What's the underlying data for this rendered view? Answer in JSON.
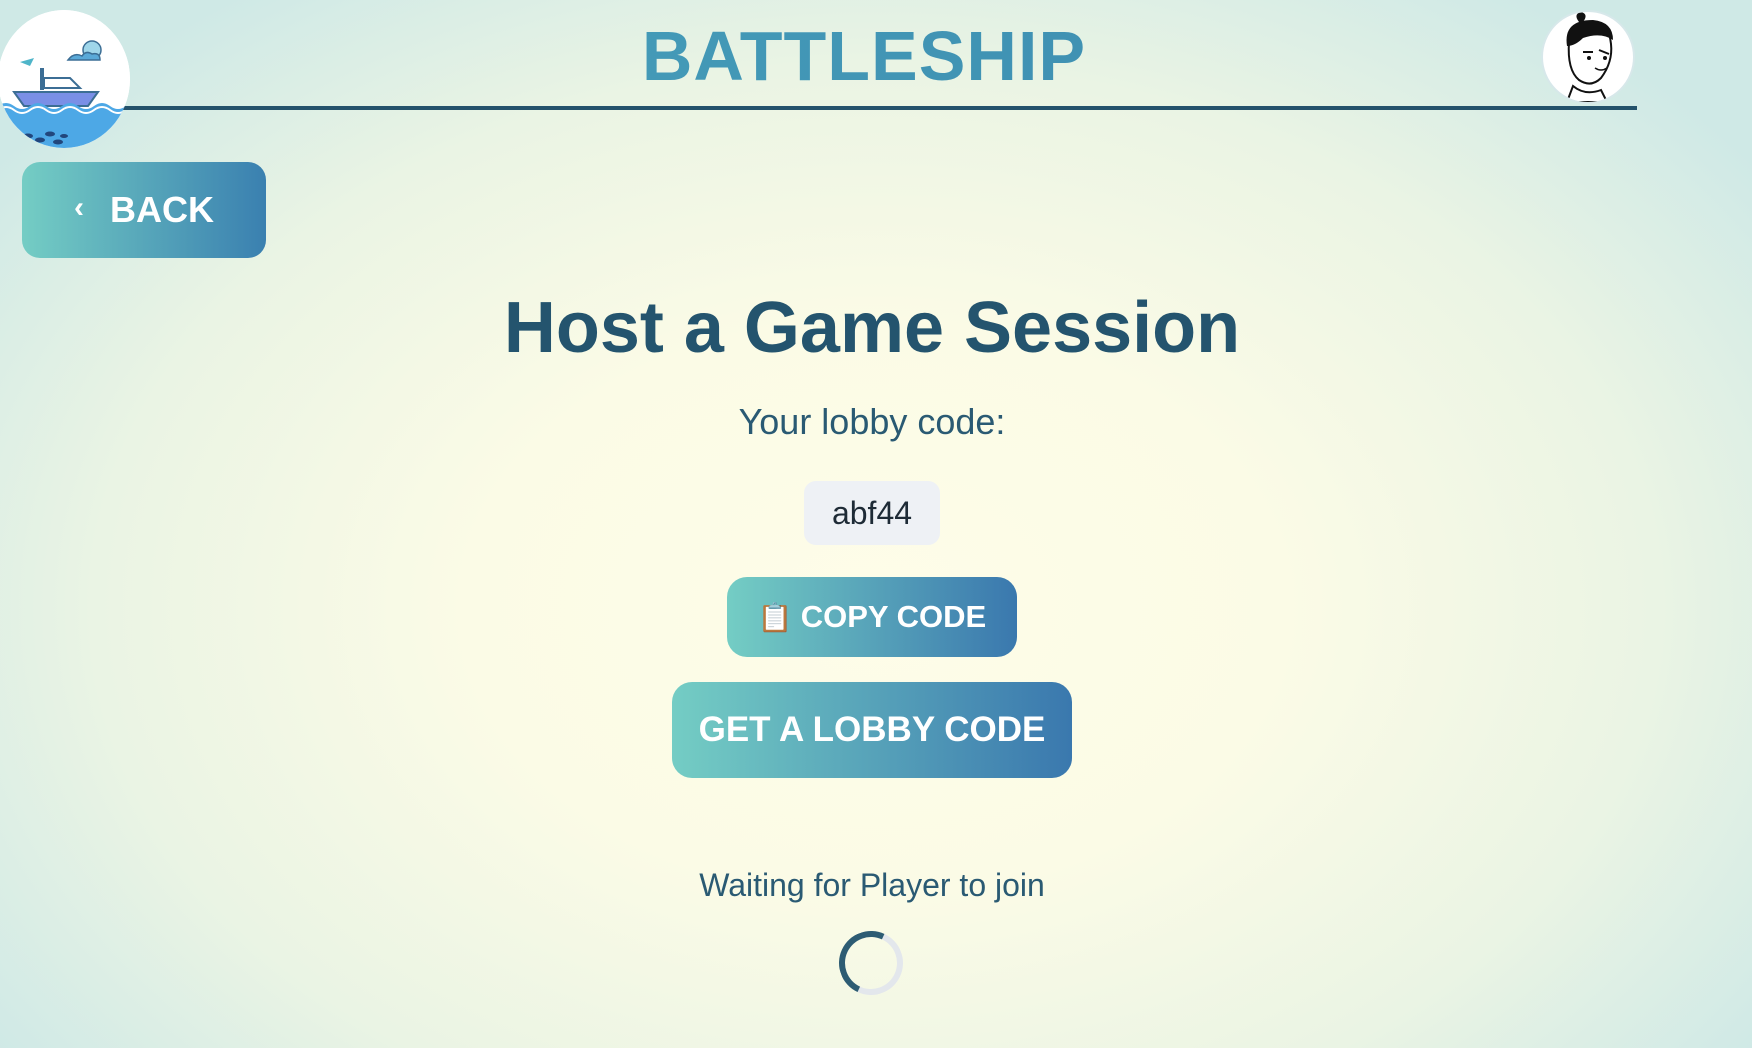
{
  "header": {
    "app_title": "BATTLESHIP",
    "logo_icon": "boat-logo-icon",
    "avatar_icon": "user-avatar-icon"
  },
  "nav": {
    "back_label": "BACK",
    "back_icon": "chevron-left-icon",
    "back_glyph": "‹"
  },
  "main": {
    "title": "Host a Game Session",
    "lobby_label": "Your lobby code:",
    "lobby_code": "abf44",
    "copy_icon": "clipboard-icon",
    "copy_glyph": "📋",
    "copy_label": "COPY CODE",
    "get_code_label": "GET A LOBBY CODE",
    "waiting_text": "Waiting for Player to join"
  },
  "colors": {
    "primary_text": "#24546e",
    "title_accent": "#3e93b4",
    "button_gradient_start": "#74cdc4",
    "button_gradient_end": "#3a78ae",
    "code_background": "#eef1f5"
  }
}
